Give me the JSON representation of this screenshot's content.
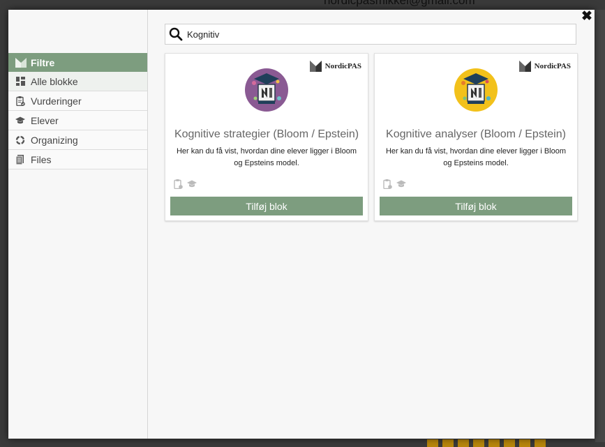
{
  "background": {
    "email": "nordicpasmikkel@gmail.com"
  },
  "sidebar": {
    "header": "Filtre",
    "items": [
      {
        "label": "Alle blokke",
        "icon": "grid-icon"
      },
      {
        "label": "Vurderinger",
        "icon": "clipboard-check-icon"
      },
      {
        "label": "Elever",
        "icon": "graduation-cap-icon"
      },
      {
        "label": "Organizing",
        "icon": "cycle-icon"
      },
      {
        "label": "Files",
        "icon": "document-icon"
      }
    ]
  },
  "search": {
    "value": "Kognitiv"
  },
  "cards": [
    {
      "brand": "NordicPAS",
      "title": "Kognitive strategier (Bloom / Epstein)",
      "description": "Her kan du få vist, hvordan dine elever ligger i Bloom og Epsteins model.",
      "button": "Tilføj blok",
      "hero_color": "#8a5a93"
    },
    {
      "brand": "NordicPAS",
      "title": "Kognitive analyser (Bloom / Epstein)",
      "description": "Her kan du få vist, hvordan dine elever ligger i Bloom og Epsteins model.",
      "button": "Tilføj blok",
      "hero_color": "#f2c11b"
    }
  ],
  "colors": {
    "accent": "#7d9d7f"
  }
}
